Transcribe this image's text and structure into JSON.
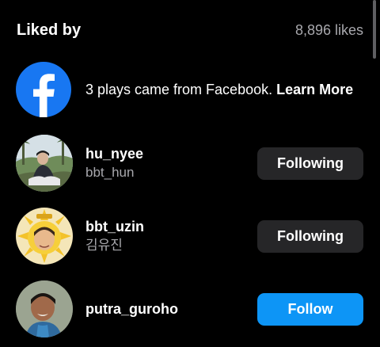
{
  "header": {
    "title": "Liked by",
    "likes_count": "8,896 likes"
  },
  "facebook_notice": {
    "icon": "facebook-logo-icon",
    "text": "3 plays came from Facebook.",
    "link_label": "Learn More",
    "brand_color": "#1877f2"
  },
  "users": [
    {
      "username": "hu_nyee",
      "subname": "bbt_hun",
      "button_label": "Following",
      "state": "following"
    },
    {
      "username": "bbt_uzin",
      "subname": "김유진",
      "button_label": "Following",
      "state": "following"
    },
    {
      "username": "putra_guroho",
      "subname": "",
      "button_label": "Follow",
      "state": "not-following"
    }
  ],
  "colors": {
    "background": "#000000",
    "following_button": "#262628",
    "follow_button": "#0d95f6",
    "secondary_text": "#a8a8ad"
  }
}
